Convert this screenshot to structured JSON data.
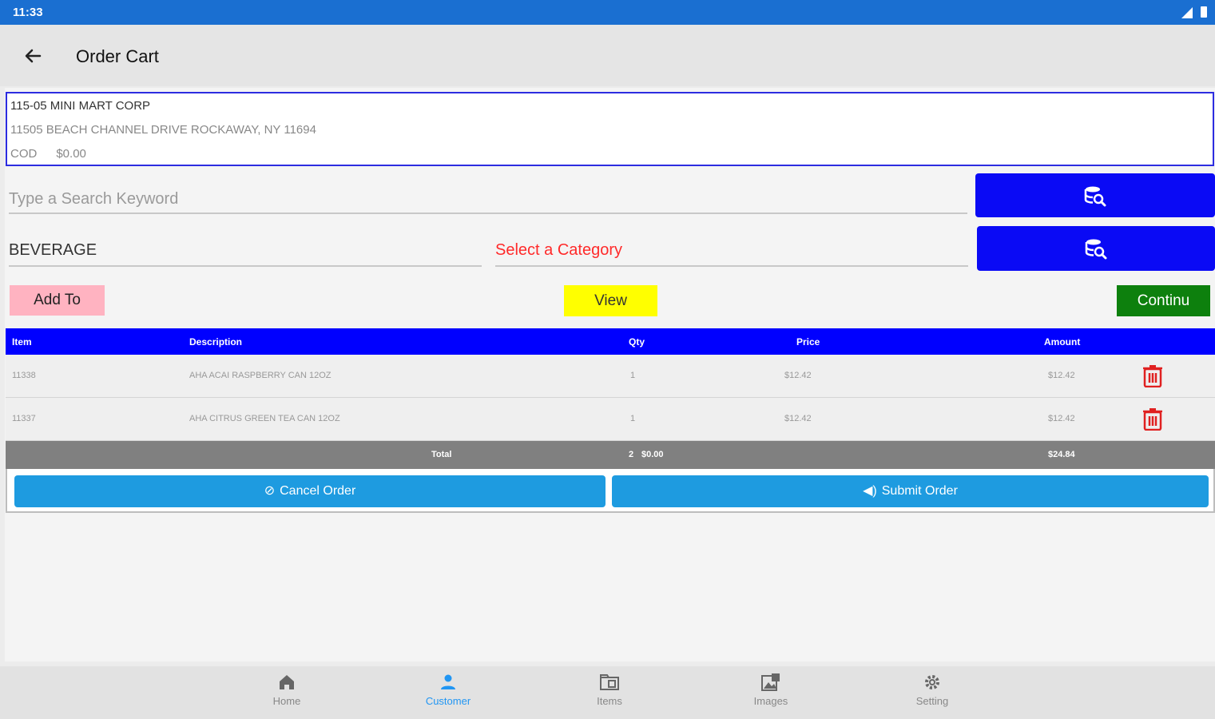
{
  "status_bar": {
    "time": "11:33"
  },
  "app_bar": {
    "title": "Order Cart"
  },
  "customer": {
    "name": "115-05 MINI MART CORP",
    "address": "11505 BEACH CHANNEL DRIVE ROCKAWAY, NY 11694",
    "terms": "COD",
    "balance": "$0.00"
  },
  "search": {
    "placeholder": "Type a Search Keyword"
  },
  "category": {
    "value": "BEVERAGE",
    "select_label": "Select a Category"
  },
  "buttons": {
    "add": "Add To",
    "view": "View",
    "continue": "Continu"
  },
  "table": {
    "headers": {
      "item": "Item",
      "description": "Description",
      "qty": "Qty",
      "price": "Price",
      "amount": "Amount"
    },
    "rows": [
      {
        "item": "11338",
        "description": "AHA ACAI RASPBERRY CAN 12OZ",
        "qty": "1",
        "price": "$12.42",
        "amount": "$12.42"
      },
      {
        "item": "11337",
        "description": "AHA CITRUS GREEN TEA CAN 12OZ",
        "qty": "1",
        "price": "$12.42",
        "amount": "$12.42"
      }
    ],
    "total": {
      "label": "Total",
      "qty": "2",
      "cases": "$0.00",
      "amount": "$24.84"
    }
  },
  "actions": {
    "cancel": "Cancel Order",
    "submit": "Submit Order"
  },
  "nav": {
    "items": [
      {
        "label": "Home",
        "icon": "home-icon"
      },
      {
        "label": "Customer",
        "icon": "person-icon",
        "active": true
      },
      {
        "label": "Items",
        "icon": "folder-icon"
      },
      {
        "label": "Images",
        "icon": "images-icon"
      },
      {
        "label": "Setting",
        "icon": "gear-icon"
      }
    ]
  },
  "colors": {
    "status_bar": "#1a6fd1",
    "primary_blue": "#0a0af5",
    "add_button": "#ffb3c1",
    "view_button": "#ffff00",
    "continue_button": "#0d800d",
    "action_button": "#1e9be0",
    "category_prompt": "#ff2a2a",
    "delete_icon": "#e02020",
    "active_nav": "#2196f3"
  }
}
